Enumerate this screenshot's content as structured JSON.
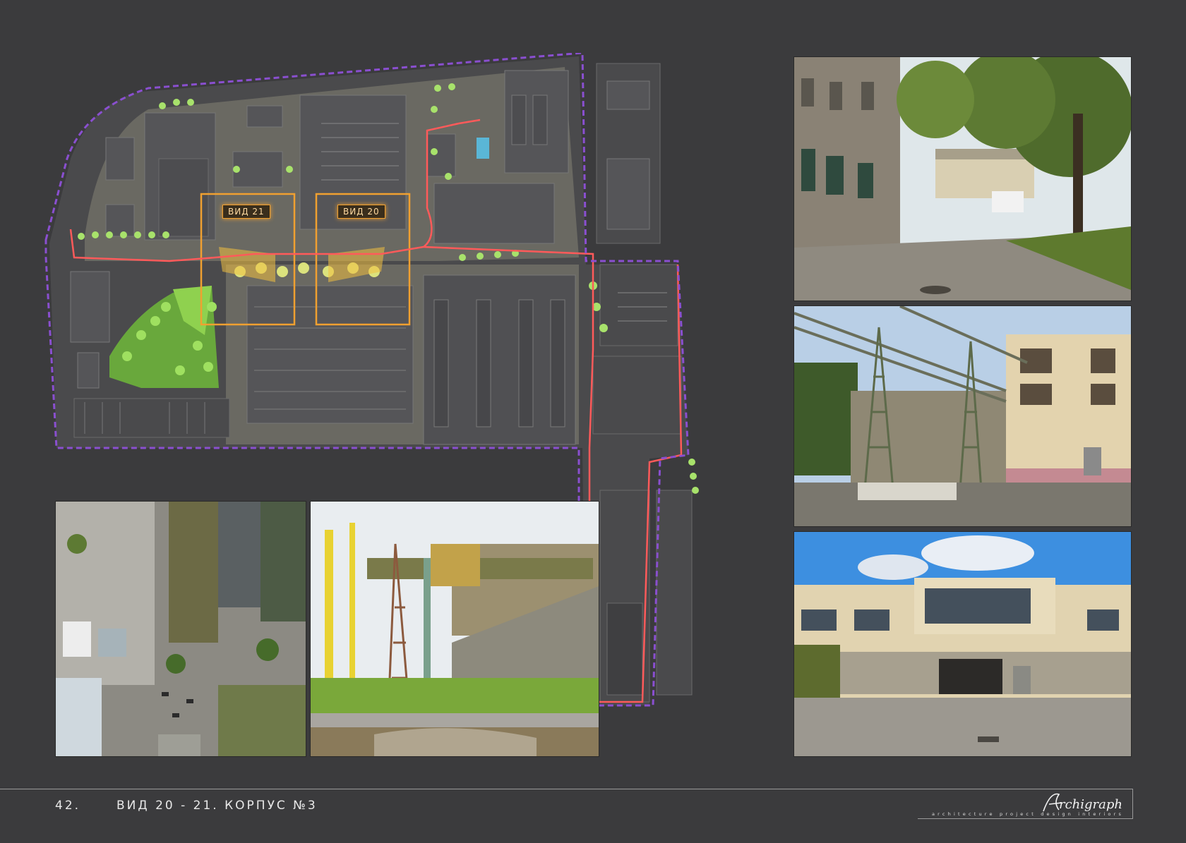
{
  "plan": {
    "views": [
      {
        "label": "ВИД 21"
      },
      {
        "label": "ВИД 20"
      }
    ]
  },
  "photos": [
    {
      "name": "photo-courtyard-trees"
    },
    {
      "name": "photo-pipe-towers"
    },
    {
      "name": "photo-building-facade"
    },
    {
      "name": "photo-aerial"
    },
    {
      "name": "photo-crane-gantry"
    }
  ],
  "footer": {
    "page_number": "42.",
    "title": "ВИД 20 - 21. КОРПУС №3",
    "logo_text": "Archigraph",
    "tagline": "architecture  project  design  interiors"
  },
  "colors": {
    "background": "#3b3b3d",
    "boundary": "#8a4fd0",
    "route": "#ff5a5a",
    "view_frame": "#f0a030",
    "greenery": "#8fd14f"
  }
}
